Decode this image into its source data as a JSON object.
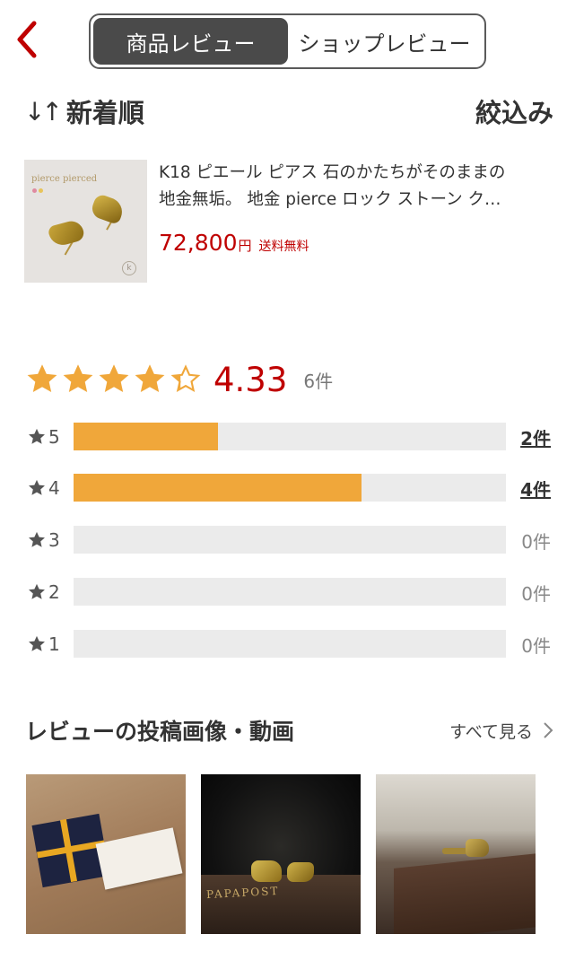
{
  "header": {
    "back_icon": "chevron-left-icon",
    "tabs": [
      {
        "label": "商品レビュー",
        "active": true
      },
      {
        "label": "ショップレビュー",
        "active": false
      }
    ],
    "accent_color": "#bf0000"
  },
  "sort": {
    "icon": "sort-arrows-icon",
    "arrows": "↓↑",
    "label": "新着順",
    "filter_label": "絞込み"
  },
  "product": {
    "thumb_brand": "pierce pierced",
    "thumb_logo": "k",
    "title_line1": "K18 ピエール ピアス 石のかたちがそのままの",
    "title_line2": "地金無垢。 地金 pierce ロック ストーン ク…",
    "price": "72,800",
    "price_unit": "円",
    "shipping": "送料無料"
  },
  "rating": {
    "average": "4.33",
    "average_value": 4.33,
    "total_count": "6件",
    "star_color": "#f0a73a",
    "breakdown": [
      {
        "label": "5",
        "count": "2件",
        "fill_percent": 33.3,
        "linked": true
      },
      {
        "label": "4",
        "count": "4件",
        "fill_percent": 66.7,
        "linked": true
      },
      {
        "label": "3",
        "count": "0件",
        "fill_percent": 0,
        "linked": false
      },
      {
        "label": "2",
        "count": "0件",
        "fill_percent": 0,
        "linked": false
      },
      {
        "label": "1",
        "count": "0件",
        "fill_percent": 0,
        "linked": false
      }
    ]
  },
  "review_images": {
    "title": "レビューの投稿画像・動画",
    "see_all": "すべて見る",
    "g2_text": "PAPAPOST"
  }
}
